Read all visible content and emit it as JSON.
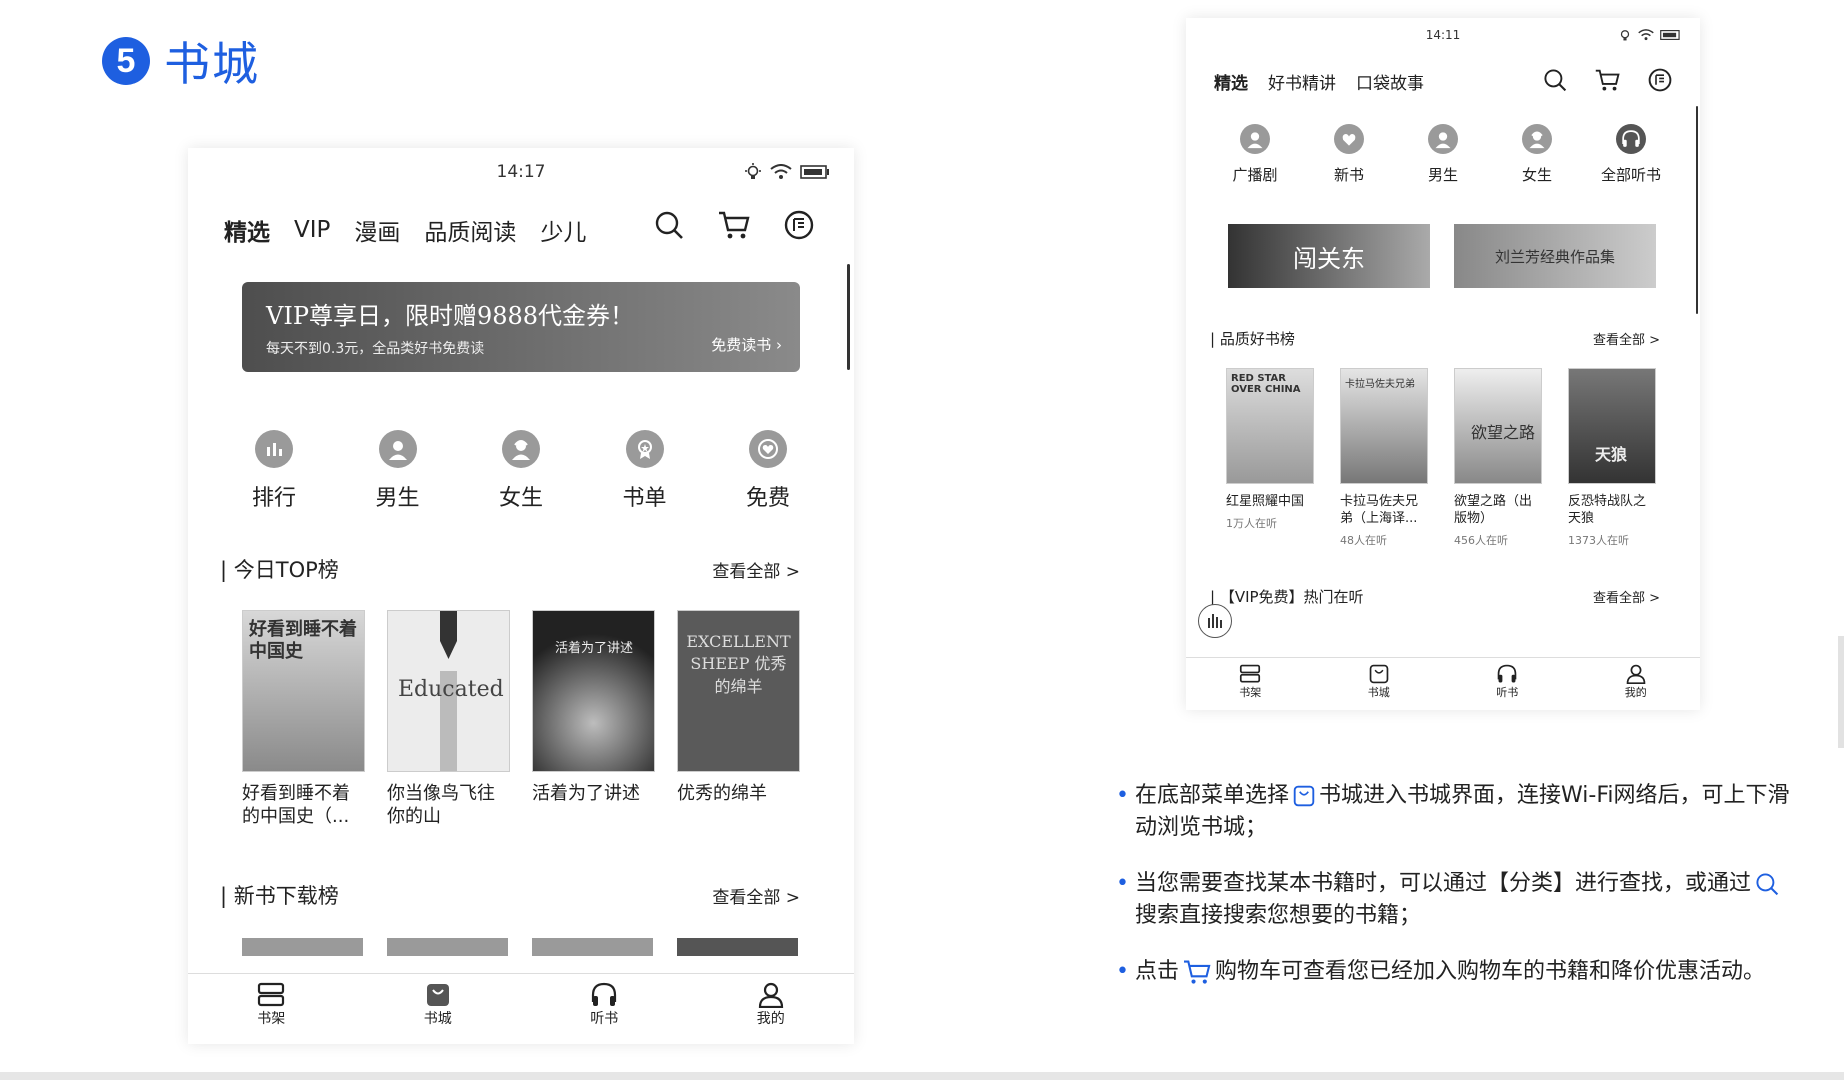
{
  "section": {
    "number": "5",
    "title": "书城"
  },
  "deviceA": {
    "time": "14:17",
    "tabs": [
      "精选",
      "VIP",
      "漫画",
      "品质阅读",
      "少儿"
    ],
    "banner": {
      "title": "VIP尊享日，限时赠9888代金券！",
      "subtitle": "每天不到0.3元，全品类好书免费读",
      "cta": "免费读书"
    },
    "categories": [
      "排行",
      "男生",
      "女生",
      "书单",
      "免费"
    ],
    "top_list": {
      "title": "今日TOP榜",
      "more": "查看全部 >",
      "books": [
        {
          "title": "好看到睡不着的中国史（...",
          "cover_text": "好看到睡不着 中国史"
        },
        {
          "title": "你当像鸟飞往你的山",
          "cover_text": "Educated"
        },
        {
          "title": "活着为了讲述",
          "cover_text": "活着为了讲述"
        },
        {
          "title": "优秀的绵羊",
          "cover_text": "EXCELLENT SHEEP 优秀的绵羊"
        }
      ]
    },
    "new_list": {
      "title": "新书下载榜",
      "more": "查看全部 >"
    },
    "nav": [
      "书架",
      "书城",
      "听书",
      "我的"
    ]
  },
  "deviceB": {
    "time": "14:11",
    "tabs": [
      "精选",
      "好书精讲",
      "口袋故事"
    ],
    "categories": [
      "广播剧",
      "新书",
      "男生",
      "女生",
      "全部听书"
    ],
    "promos": [
      "闯关东",
      "刘兰芳经典作品集"
    ],
    "quality_list": {
      "title": "品质好书榜",
      "more": "查看全部 >",
      "books": [
        {
          "title": "红星照耀中国",
          "listeners": "1万人在听",
          "cover_text": "RED STAR OVER CHINA"
        },
        {
          "title": "卡拉马佐夫兄弟（上海译...",
          "listeners": "48人在听",
          "cover_text": "卡拉马佐夫兄弟"
        },
        {
          "title": "欲望之路（出版物）",
          "listeners": "456人在听",
          "cover_text": "欲望之路"
        },
        {
          "title": "反恐特战队之天狼",
          "listeners": "1373人在听",
          "cover_text": "天狼"
        }
      ]
    },
    "vip_list": {
      "title": "【VIP免费】热门在听",
      "more": "查看全部 >"
    },
    "nav": [
      "书架",
      "书城",
      "听书",
      "我的"
    ]
  },
  "instructions": [
    {
      "before": "在底部菜单选择",
      "after": "书城进入书城界面，连接Wi-Fi网络后，可上下滑动浏览书城；"
    },
    {
      "before": "当您需要查找某本书籍时，可以通过【分类】进行查找，或通过",
      "after": "搜索直接搜索您想要的书籍；"
    },
    {
      "before": "点击",
      "after": "购物车可查看您已经加入购物车的书籍和降价优惠活动。"
    }
  ]
}
